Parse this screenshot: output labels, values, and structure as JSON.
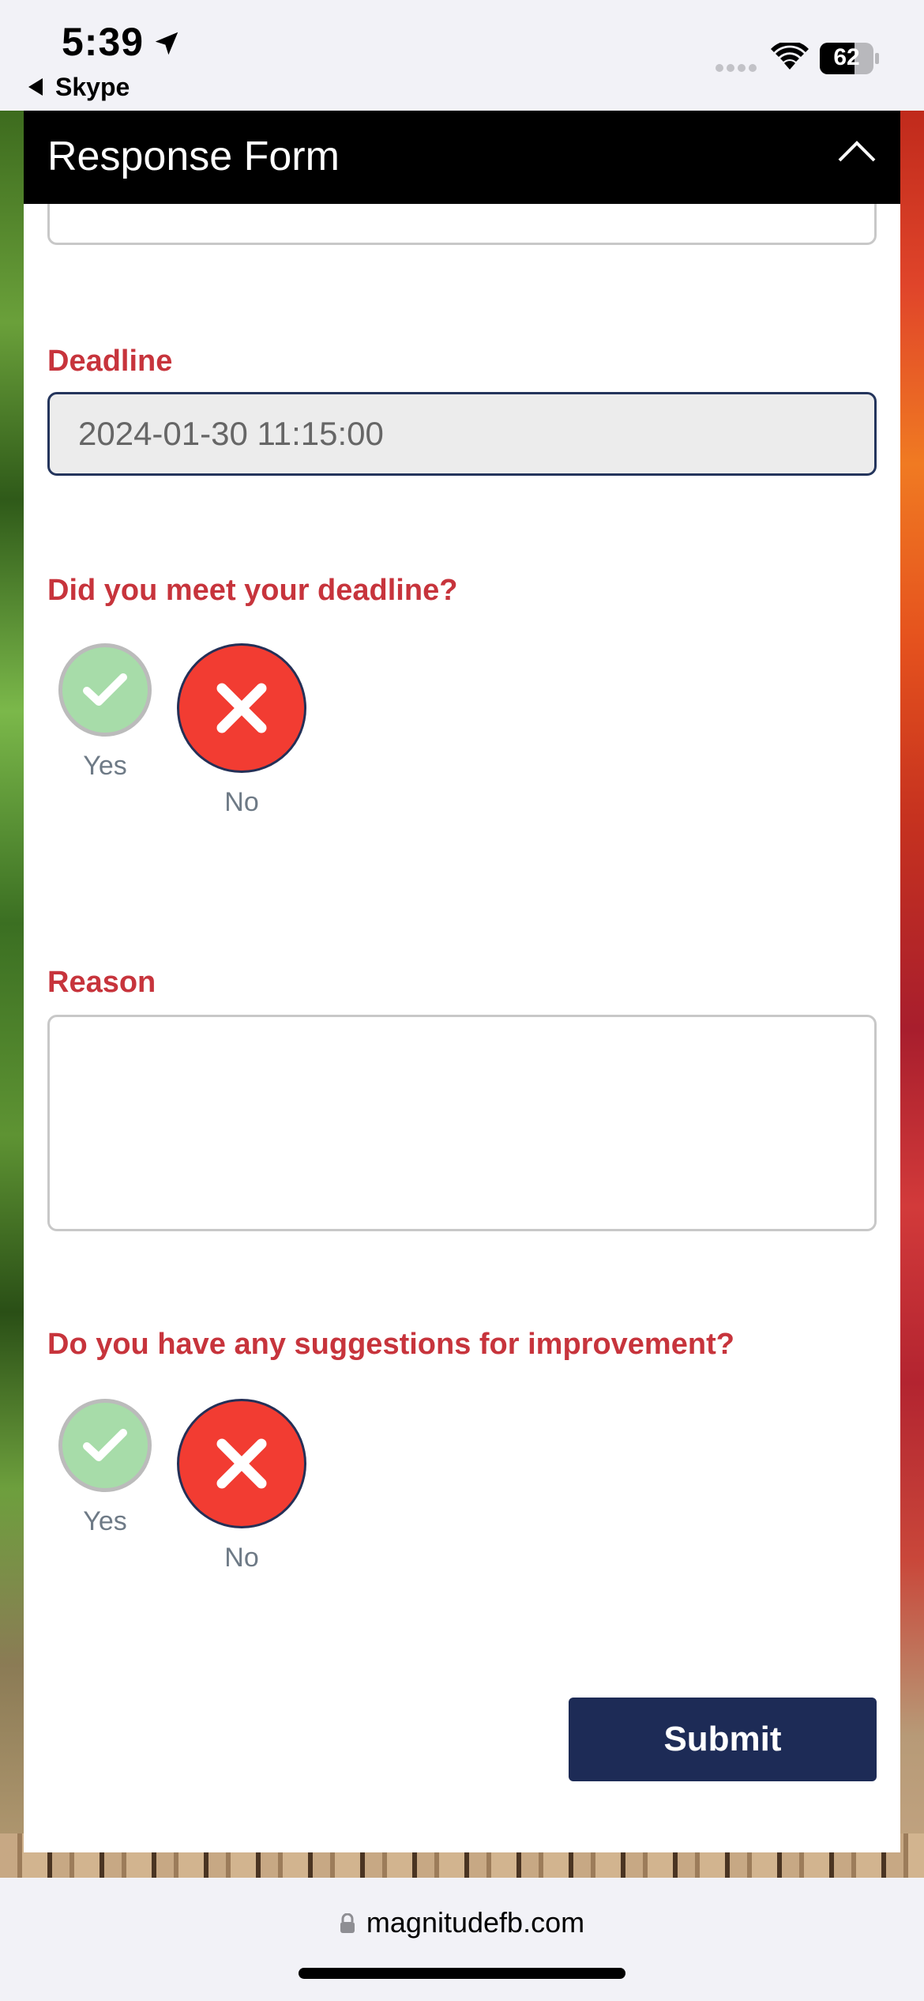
{
  "status_bar": {
    "time": "5:39",
    "back_app": "Skype",
    "battery_level": "62"
  },
  "panel": {
    "title": "Response Form"
  },
  "form": {
    "deadline_label": "Deadline",
    "deadline_value": "2024-01-30 11:15:00",
    "met_deadline_question": "Did you meet your deadline?",
    "met_deadline_yes": "Yes",
    "met_deadline_no": "No",
    "reason_label": "Reason",
    "reason_value": "",
    "suggestions_question": "Do you have any suggestions for improvement?",
    "suggestions_yes": "Yes",
    "suggestions_no": "No",
    "submit_label": "Submit"
  },
  "browser": {
    "url": "magnitudefb.com"
  },
  "colors": {
    "label_red": "#c7343c",
    "submit_navy": "#1d2b56",
    "no_red": "#f23c32",
    "yes_green": "#a7dca9"
  }
}
